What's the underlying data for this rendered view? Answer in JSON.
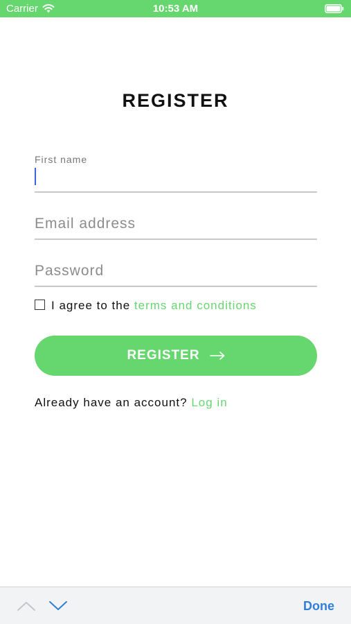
{
  "status_bar": {
    "carrier": "Carrier",
    "time": "10:53 AM",
    "wifi_icon": "wifi-icon",
    "battery_icon": "battery-icon",
    "background_color": "#66d66f"
  },
  "form": {
    "title": "REGISTER",
    "fields": [
      {
        "label": "First name",
        "value": "",
        "state": "focused"
      },
      {
        "placeholder": "Email address",
        "value": ""
      },
      {
        "placeholder": "Password",
        "value": ""
      }
    ],
    "terms": {
      "checked": false,
      "prefix": "I agree to the",
      "link_text": "terms and conditions"
    },
    "submit_label": "REGISTER",
    "submit_icon": "arrow-right-icon",
    "login_prompt": "Already have an account?",
    "login_link": "Log in"
  },
  "keyboard_accessory": {
    "prev_icon": "chevron-up-icon",
    "next_icon": "chevron-down-icon",
    "done_label": "Done"
  },
  "colors": {
    "accent": "#66d66f",
    "caret": "#3b63e0",
    "done": "#2f7fd9"
  }
}
